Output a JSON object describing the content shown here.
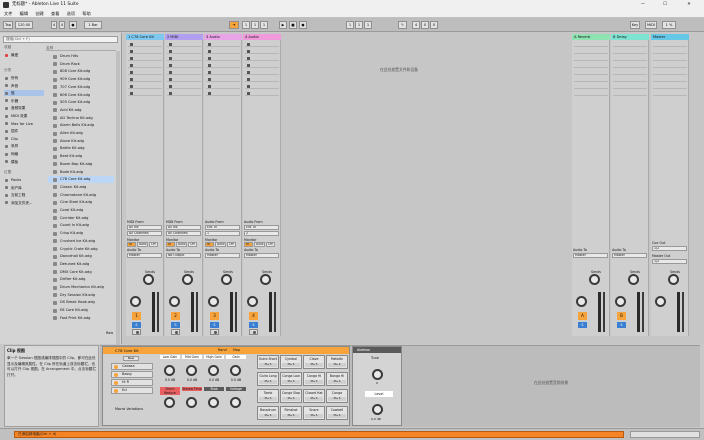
{
  "window": {
    "title": "无标题* - Ableton Live 11 Suite"
  },
  "window_controls": {
    "minimize": "—",
    "maximize": "☐",
    "close": "✕"
  },
  "menu": [
    "文件",
    "编辑",
    "创建",
    "查看",
    "选项",
    "帮助"
  ],
  "control_bar": {
    "tap": "Tap",
    "tempo": "120.00",
    "sig_num": "4",
    "sig_den": "4",
    "metronome": "●",
    "quant": "1 Bar",
    "position": [
      "1",
      "1",
      "1"
    ],
    "loop_start": [
      "1",
      "1",
      "1"
    ],
    "loop_len": [
      "4",
      "0",
      "0"
    ],
    "key": "Key",
    "midi": "MIDI",
    "cpu": "1 %"
  },
  "browser": {
    "search_placeholder": "搜索(Ctrl + F)",
    "sections": {
      "collections": "收藏",
      "categories": "分类",
      "places": "位置"
    },
    "collections": [
      "最爱"
    ],
    "categories": [
      "所有",
      "声音",
      "鼓",
      "乐器",
      "音频效果",
      "MIDI 效果",
      "Max for Live",
      "插件",
      "Clip",
      "采样",
      "网格",
      "模板"
    ],
    "places": [
      "Packs",
      "用户库",
      "当前工程",
      "添加文件夹..."
    ],
    "file_header": "名称",
    "files": [
      "Drum Hits",
      "Drum Rack",
      "808 Core Kit.adg",
      "909 Core Kit.adg",
      "707 Core Kit.adg",
      "606 Core Kit.adg",
      "505 Core Kit.adg",
      "Acid Kit.adg",
      "AG Techno Kit.adg",
      "Alarm Bells Kit.adg",
      "Alien Kit.adg",
      "Alone Kit.adg",
      "Battle Kit.adg",
      "Beat Kit.adg",
      "Boom Bap Kit.adg",
      "Bode Kit.adg",
      "C78 Core Kit.adg",
      "Classic Kit.adg",
      "Chromatone Kit.adg",
      "Cine Steel Kit.adg",
      "Coral Kit.adg",
      "Corridor Kit.adg",
      "Count In Kit.adg",
      "Crisp Kit.adg",
      "Crushed Ice Kit.adg",
      "Cryptic Crate Kit.adg",
      "Dancehall Kit.adg",
      "Detuned Kit.adg",
      "DMX Core Kit.adg",
      "Drifter Kit.adg",
      "Drum Mechanics Kit.adg",
      "Dry Session Kit.adg",
      "DS Break Hook.adg",
      "E8 Core Kit.adg",
      "Fast Print Kit.adg"
    ],
    "selected_file": "C78 Core Kit.adg",
    "raw": "Raw"
  },
  "tracks": [
    {
      "name": "1 C78 Core Kit",
      "color": "#7ec8f0",
      "type": "midi",
      "midi_from": "All Ins",
      "channel": "All Channels",
      "monitor": "In",
      "audio_to": "Master",
      "num": "1"
    },
    {
      "name": "2 MIDI",
      "color": "#b39ff0",
      "type": "midi",
      "midi_from": "All Ins",
      "channel": "All Channels",
      "monitor": "In",
      "audio_to": "No Output",
      "num": "2"
    },
    {
      "name": "3 Audio",
      "color": "#e9a4e8",
      "type": "audio",
      "midi_from": "Ext. In",
      "channel": "1",
      "monitor": "In",
      "audio_to": "Master",
      "num": "3"
    },
    {
      "name": "4 Audio",
      "color": "#f09adb",
      "type": "audio",
      "midi_from": "Ext. In",
      "channel": "2",
      "monitor": "In",
      "audio_to": "Master",
      "num": "4"
    }
  ],
  "returns": [
    {
      "name": "A Reverb",
      "color": "#8fe3b2",
      "audio_to": "Master",
      "letter": "A"
    },
    {
      "name": "B Delay",
      "color": "#7ee3d0",
      "audio_to": "Master",
      "letter": "B"
    }
  ],
  "master": {
    "name": "Master",
    "color": "#64c8e6",
    "cue_out": "Cue Out",
    "cue_val": "1/2",
    "master_out": "Master Out",
    "master_val": "1/2"
  },
  "labels": {
    "midi_from": "MIDI From",
    "audio_from": "Audio From",
    "monitor": "Monitor",
    "midi_to": "MIDI To",
    "audio_to": "Audio To",
    "sends": "Sends",
    "in": "In",
    "auto": "Auto",
    "off": "Off"
  },
  "session_msg": "在此处放置文件和设备",
  "info": {
    "title": "Clip 视图",
    "body": "单一个 Session 视图或编排视图中的 Clip，即可在此处显示及编辑其属性。在 Clip 所在轨道上双击标题栏，也可以打开 Clip 视图。在 Arrangement 中，点击标题栏打开。"
  },
  "drum_rack": {
    "title": "C78 Core Kit",
    "tabs": [
      "Rand",
      "Map"
    ],
    "new": "New",
    "chains": [
      "Cabasa",
      "Bassy",
      "Hi Fi",
      "Ecl"
    ],
    "macros": [
      "Low Gain",
      "Mid Gain",
      "High Gain",
      "Gain",
      "Drum Reduce",
      "Stereo Time",
      "Stab",
      "Voltage"
    ],
    "macro_value": "0.0 dB",
    "variations": "Macro Variations",
    "pads": [
      [
        "Guiro Short",
        "Cymbal",
        "Clave",
        "Metallic"
      ],
      [
        "Guiro Long",
        "Conga Low",
        "Conga Hi",
        "Bongo Hi"
      ],
      [
        "Tamb",
        "Conga Slap",
        "Closed Hat",
        "Conga"
      ],
      [
        "Bassdrum",
        "Rimshot",
        "Snare",
        "Cowbell"
      ]
    ],
    "pad_btns": "M ▸ S"
  },
  "ableton_dev": {
    "title": "Ableton",
    "tune": "Tune",
    "level": "Level",
    "tune_val": "0",
    "level_val": "0.0 dB"
  },
  "device_drop": "在此处放置音频效果",
  "status": {
    "message": "已添加到电脑(Ctrl + 4)"
  }
}
